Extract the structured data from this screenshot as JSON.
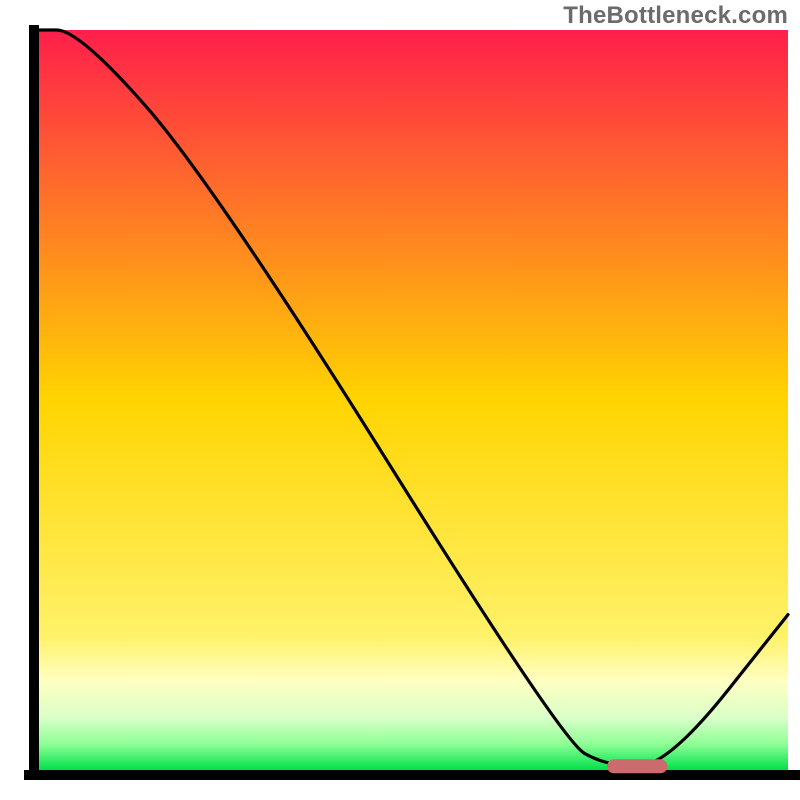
{
  "watermark": "TheBottleneck.com",
  "chart_data": {
    "type": "line",
    "title": "",
    "xlabel": "",
    "ylabel": "",
    "xlim": [
      0,
      100
    ],
    "ylim": [
      0,
      100
    ],
    "grid": false,
    "legend": false,
    "x": [
      0,
      6,
      24,
      70,
      76,
      84,
      100
    ],
    "values": [
      100,
      100,
      79,
      4,
      0.5,
      0.5,
      21
    ],
    "optimal_marker": {
      "x_start": 76,
      "x_end": 84,
      "y": 0.5
    },
    "gradient_stops": [
      {
        "offset": 0.0,
        "color": "#ff1f4b"
      },
      {
        "offset": 0.5,
        "color": "#ffd400"
      },
      {
        "offset": 0.82,
        "color": "#fff26a"
      },
      {
        "offset": 0.88,
        "color": "#ffffc2"
      },
      {
        "offset": 0.93,
        "color": "#d9ffc8"
      },
      {
        "offset": 0.965,
        "color": "#8eff96"
      },
      {
        "offset": 1.0,
        "color": "#00e04a"
      }
    ]
  }
}
